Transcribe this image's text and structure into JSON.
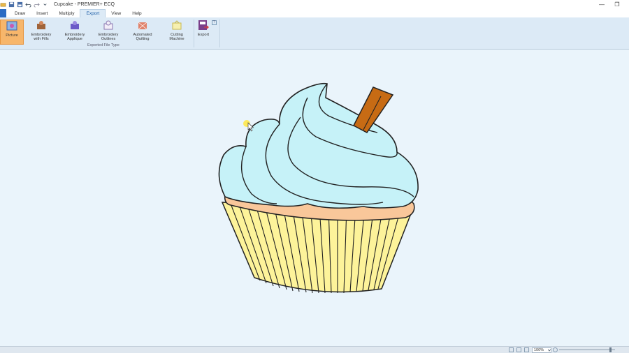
{
  "window": {
    "title": "Cupcake - PREMIER+ ECQ",
    "minimize": "—",
    "restore": "❐"
  },
  "menu": {
    "tabs": [
      {
        "label": "Draw"
      },
      {
        "label": "Insert"
      },
      {
        "label": "Multiply"
      },
      {
        "label": "Export",
        "active": true
      },
      {
        "label": "View"
      },
      {
        "label": "Help"
      }
    ]
  },
  "ribbon": {
    "buttons": [
      {
        "label": "Picture",
        "icon": "picture-icon",
        "selected": true
      },
      {
        "label": "Embroidery with Fills",
        "icon": "embroidery-fills-icon"
      },
      {
        "label": "Embroidery Applique",
        "icon": "embroidery-applique-icon"
      },
      {
        "label": "Embroidery Outlines",
        "icon": "embroidery-outlines-icon"
      },
      {
        "label": "Automated Quilting",
        "icon": "automated-quilting-icon"
      },
      {
        "label": "Cutting Machine",
        "icon": "cutting-machine-icon"
      },
      {
        "label": "Export",
        "icon": "export-icon"
      }
    ],
    "group_label": "Exported File Type",
    "help": "?"
  },
  "status": {
    "zoom": "100%"
  },
  "colors": {
    "frosting": "#c6f2f8",
    "cake": "#f9c79a",
    "wrapper": "#fdf39a",
    "stick": "#c76b14",
    "accent": "#f7b66b"
  }
}
